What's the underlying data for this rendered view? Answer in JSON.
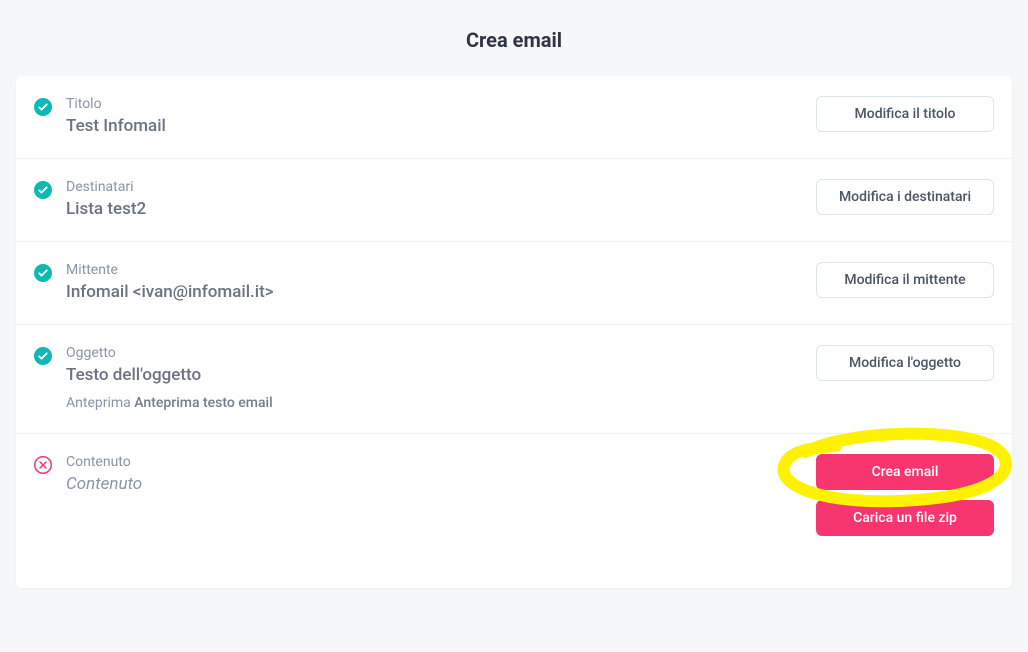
{
  "page": {
    "title": "Crea email"
  },
  "sections": {
    "title": {
      "label": "Titolo",
      "value": "Test Infomail",
      "edit": "Modifica il titolo"
    },
    "recipients": {
      "label": "Destinatari",
      "value": "Lista test2",
      "edit": "Modifica i destinatari"
    },
    "sender": {
      "label": "Mittente",
      "value": "Infomail <ivan@infomail.it>",
      "edit": "Modifica il mittente"
    },
    "subject": {
      "label": "Oggetto",
      "value": "Testo dell'oggetto",
      "preview_label": "Anteprima",
      "preview_value": "Anteprima testo email",
      "edit": "Modifica l'oggetto"
    },
    "content": {
      "label": "Contenuto",
      "value": "Contenuto",
      "create": "Crea email",
      "upload": "Carica un file zip"
    }
  },
  "status": {
    "complete_color": "#0fb9b1",
    "incomplete_color": "#f73670"
  }
}
